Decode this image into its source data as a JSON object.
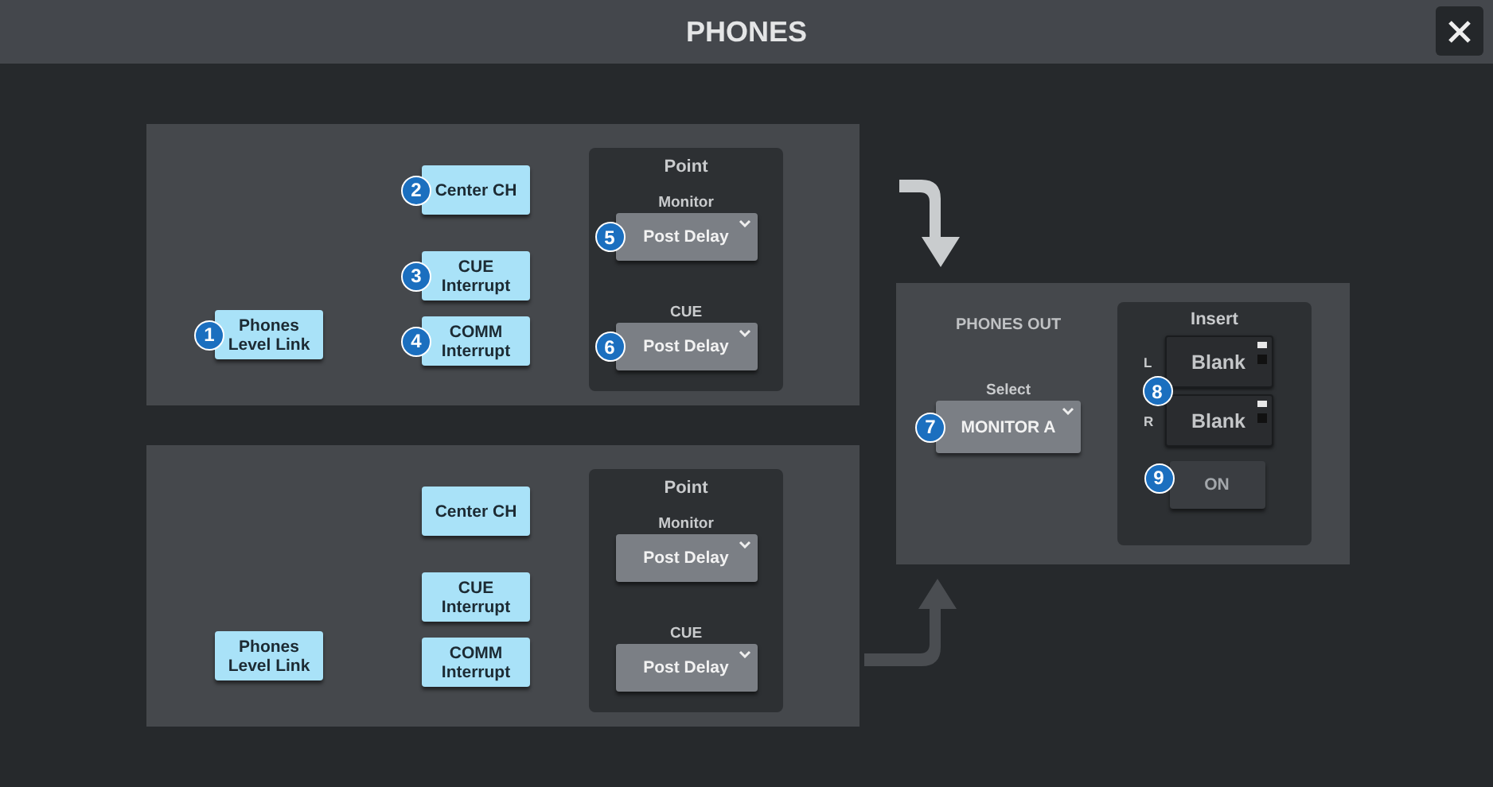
{
  "window": {
    "title": "PHONES"
  },
  "sections": [
    {
      "route_active": true,
      "toggles": [
        {
          "label": "Phones Level Link",
          "active": true,
          "callout": "1"
        },
        {
          "label": "Center CH",
          "active": true,
          "callout": "2"
        },
        {
          "label": "CUE Interrupt",
          "active": true,
          "callout": "3"
        },
        {
          "label": "COMM Interrupt",
          "active": true,
          "callout": "4"
        }
      ],
      "point": {
        "title": "Point",
        "dropdowns": [
          {
            "label": "Monitor",
            "value": "Post Delay",
            "callout": "5"
          },
          {
            "label": "CUE",
            "value": "Post Delay",
            "callout": "6"
          }
        ]
      }
    },
    {
      "route_active": false,
      "toggles": [
        {
          "label": "Phones Level Link",
          "active": true
        },
        {
          "label": "Center CH",
          "active": true
        },
        {
          "label": "CUE Interrupt",
          "active": true
        },
        {
          "label": "COMM Interrupt",
          "active": true
        }
      ],
      "point": {
        "title": "Point",
        "dropdowns": [
          {
            "label": "Monitor",
            "value": "Post Delay"
          },
          {
            "label": "CUE",
            "value": "Post Delay"
          }
        ]
      }
    }
  ],
  "phones_out": {
    "title": "PHONES OUT",
    "select": {
      "label": "Select",
      "value": "MONITOR A",
      "callout": "7"
    },
    "insert": {
      "title": "Insert",
      "callout": "8",
      "channels": [
        {
          "label": "L",
          "value": "Blank"
        },
        {
          "label": "R",
          "value": "Blank"
        }
      ],
      "toggle": {
        "label": "ON",
        "active": false,
        "callout": "9"
      }
    }
  }
}
